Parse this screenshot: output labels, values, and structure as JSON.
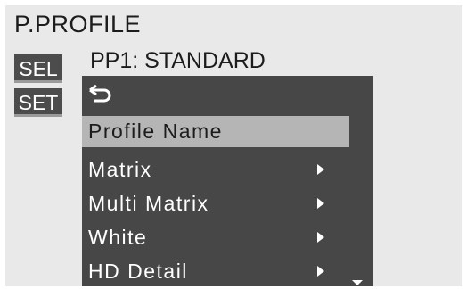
{
  "screen": {
    "title": "P.PROFILE",
    "profile_label": "PP1: STANDARD"
  },
  "side_keys": {
    "sel": "SEL",
    "set": "SET"
  },
  "menu": {
    "back_icon": "return-arrow-icon",
    "items": [
      {
        "label": "Profile Name",
        "selected": true,
        "has_submenu": false
      },
      {
        "label": "Matrix",
        "selected": false,
        "has_submenu": true
      },
      {
        "label": "Multi Matrix",
        "selected": false,
        "has_submenu": true
      },
      {
        "label": "White",
        "selected": false,
        "has_submenu": true
      },
      {
        "label": "HD Detail",
        "selected": false,
        "has_submenu": true
      }
    ],
    "scroll_indicator": "scroll-down-icon"
  },
  "colors": {
    "panel": "#474747",
    "highlight": "#b5b5b5",
    "side_key": "#4c4c4c"
  }
}
